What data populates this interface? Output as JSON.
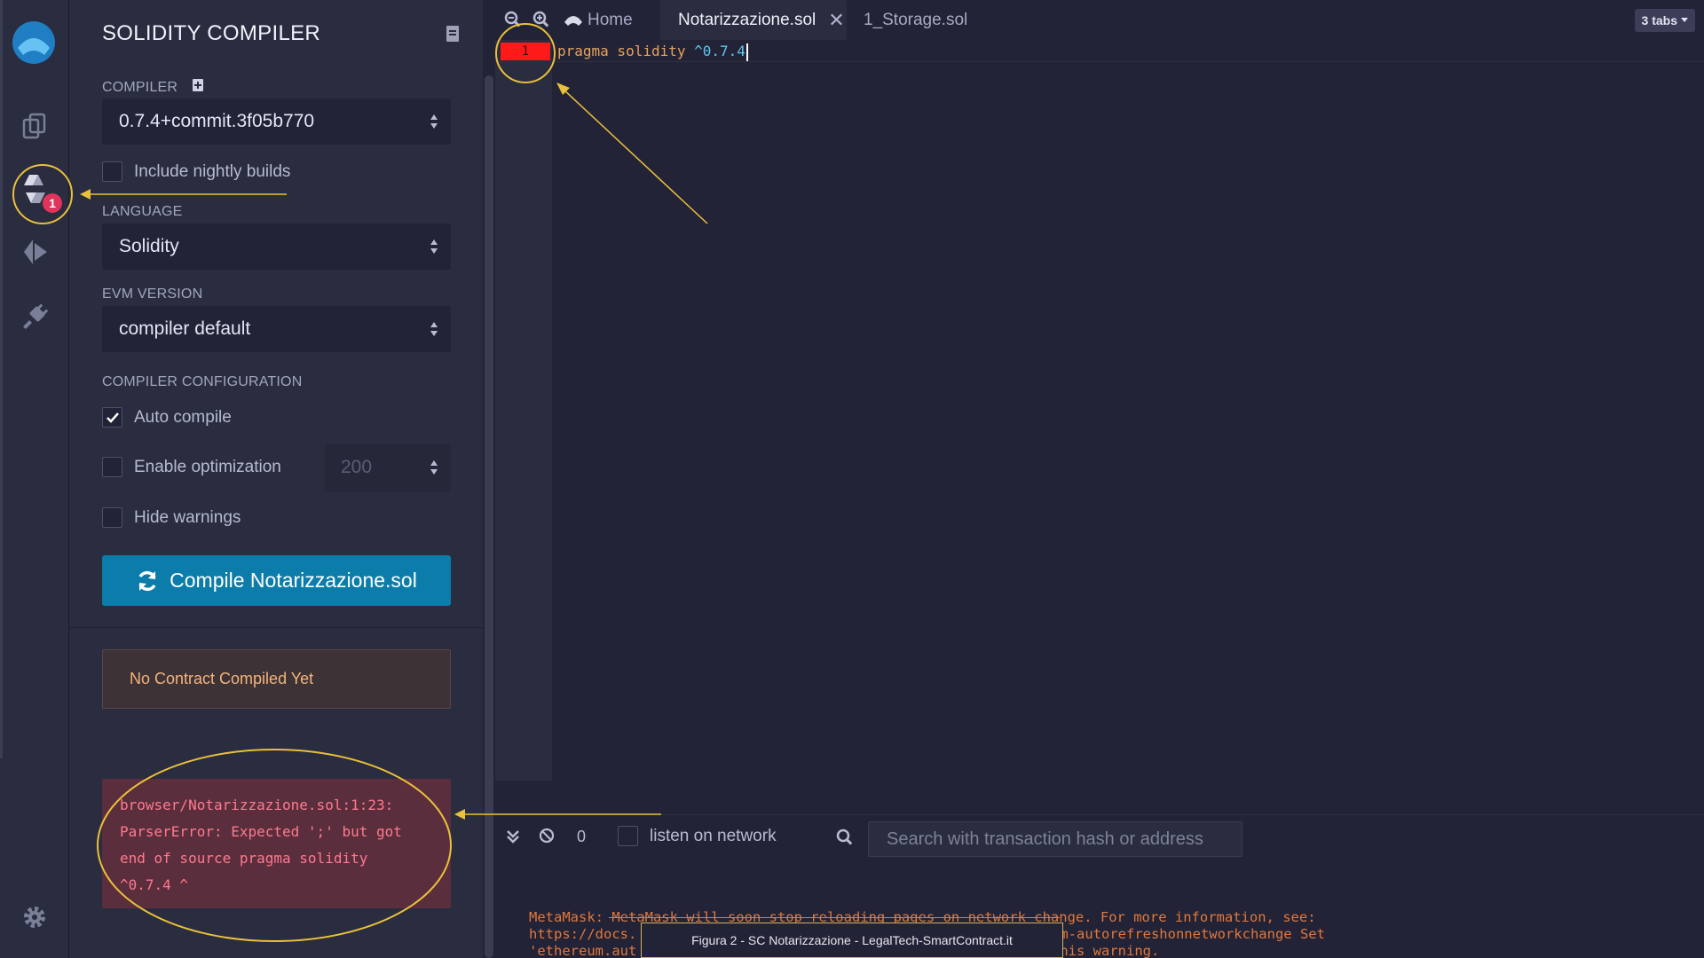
{
  "app": {
    "accent": "#0c7dab",
    "error": "#ff7a8e"
  },
  "rail": {
    "icons": [
      "remix-logo-icon",
      "file-explorer-icon",
      "solidity-compiler-icon",
      "deploy-run-icon",
      "plugin-manager-icon",
      "settings-icon"
    ],
    "compiler_badge": "1"
  },
  "panel": {
    "title": "SOLIDITY COMPILER",
    "compiler_label": "COMPILER",
    "compiler_value": "0.7.4+commit.3f05b770",
    "nightly_label": "Include nightly builds",
    "language_label": "LANGUAGE",
    "language_value": "Solidity",
    "evm_label": "EVM VERSION",
    "evm_value": "compiler default",
    "config_label": "COMPILER CONFIGURATION",
    "auto_compile_label": "Auto compile",
    "auto_compile_checked": true,
    "optimization_label": "Enable optimization",
    "optimization_runs": "200",
    "hide_warnings_label": "Hide warnings",
    "compile_button": "Compile Notarizzazione.sol",
    "no_contract": "No Contract Compiled Yet",
    "error": {
      "line1": "browser/Notarizzazione.sol:1:23:",
      "line2": "ParserError: Expected ';' but got",
      "line3": "end of source pragma solidity",
      "line4": "^0.7.4 ^"
    }
  },
  "tabs": {
    "home": "Home",
    "active": "Notarizzazione.sol",
    "other": "1_Storage.sol",
    "count": "3 tabs"
  },
  "editor": {
    "line_number": "1",
    "code_prefix": "pragma solidity ",
    "code_version": "^0.7.4"
  },
  "terminal": {
    "pending_count": "0",
    "listen_label": "listen on network",
    "search_placeholder": "Search with transaction hash or address",
    "line1": "MetaMask: MetaMask will soon stop reloading pages on network change. For more information, see:",
    "line2a": "https://docs.",
    "line2b": "m-autorefreshonnetworkchange Set",
    "line3a": "'ethereum.aut",
    "line3b": "his warning."
  },
  "caption": "Figura 2 - SC Notarizzazione -  LegalTech-SmartContract.it"
}
